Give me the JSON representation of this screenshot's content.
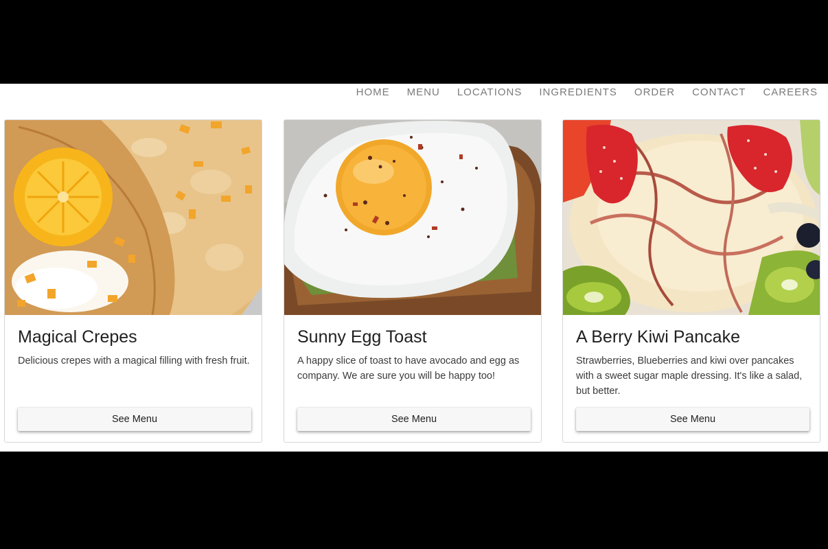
{
  "nav": {
    "items": [
      {
        "label": "HOME"
      },
      {
        "label": "MENU"
      },
      {
        "label": "LOCATIONS"
      },
      {
        "label": "INGREDIENTS"
      },
      {
        "label": "ORDER"
      },
      {
        "label": "CONTACT"
      },
      {
        "label": "CAREERS"
      }
    ]
  },
  "cards": [
    {
      "title": "Magical Crepes",
      "description": "Delicious crepes with a magical filling with fresh fruit.",
      "button_label": "See Menu",
      "image": "crepes-with-orange-photo"
    },
    {
      "title": "Sunny Egg Toast",
      "description": "A happy slice of toast to have avocado and egg as company. We are sure you will be happy too!",
      "button_label": "See Menu",
      "image": "fried-egg-avocado-toast-photo"
    },
    {
      "title": "A Berry Kiwi Pancake",
      "description": "Strawberries, Blueberries and kiwi over pancakes with a sweet sugar maple dressing. It's like a salad, but better.",
      "button_label": "See Menu",
      "image": "berry-kiwi-pancake-photo"
    }
  ],
  "colors": {
    "background": "#ffffff",
    "letterbox": "#000000",
    "nav_text": "#7a7a7a",
    "button_bg": "#f7f7f7"
  }
}
